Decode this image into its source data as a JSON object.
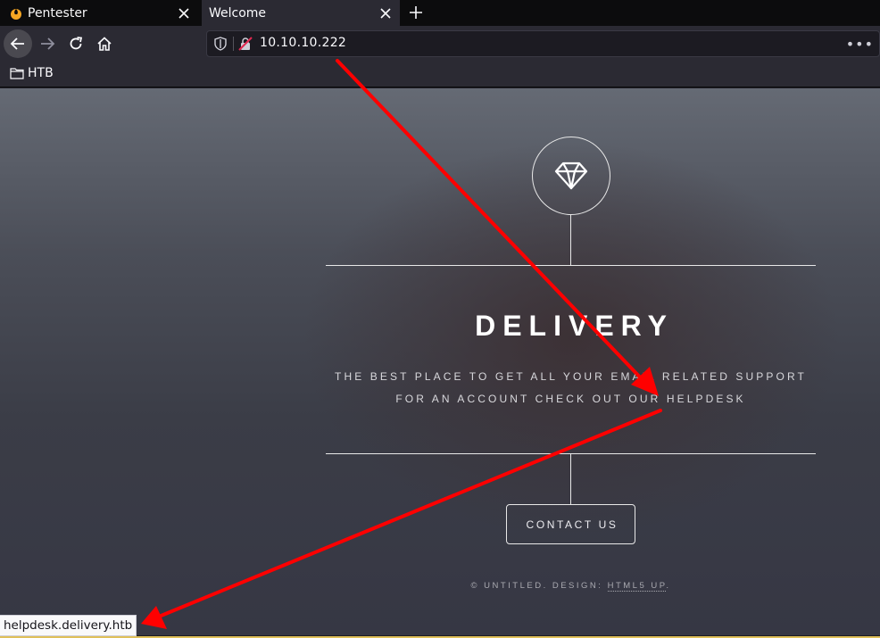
{
  "browser": {
    "tabs": [
      {
        "title": "Pentester",
        "active": false,
        "favicon": "flame-icon"
      },
      {
        "title": "Welcome",
        "active": true
      }
    ],
    "url": "10.10.10.222",
    "bookmarks": [
      {
        "label": "HTB",
        "icon": "folder-icon"
      }
    ],
    "status_link": "helpdesk.delivery.htb"
  },
  "page": {
    "icon": "diamond-icon",
    "title": "DELIVERY",
    "tagline_1": "THE BEST PLACE TO GET ALL YOUR EMAIL RELATED SUPPORT",
    "tagline_2": "FOR AN ACCOUNT CHECK OUT OUR HELPDESK",
    "contact_label": "CONTACT US",
    "footer_prefix": "© UNTITLED. DESIGN:",
    "footer_link": "HTML5 UP",
    "footer_suffix": "."
  },
  "colors": {
    "annotation_arrow": "#ff0000",
    "toolbar": "#2b2a33",
    "tabstrip": "#0c0c0d"
  }
}
